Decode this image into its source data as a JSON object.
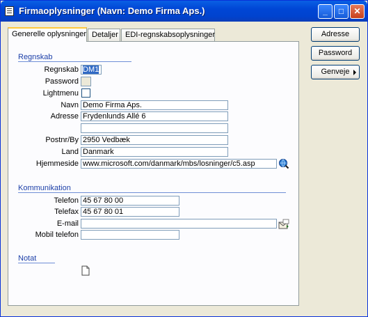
{
  "window": {
    "title": "Firmaoplysninger (Navn: Demo Firma Aps.)"
  },
  "titlebar_buttons": {
    "minimize": "_",
    "maximize": "□",
    "close": "✕"
  },
  "tabs": [
    {
      "label": "Generelle oplysninger",
      "active": true
    },
    {
      "label": "Detaljer",
      "active": false
    },
    {
      "label": "EDI-regnskabsoplysninger",
      "active": false
    }
  ],
  "side_buttons": {
    "adresse": "Adresse",
    "password": "Password",
    "genveje": "Genveje"
  },
  "regnskab": {
    "section": "Regnskab",
    "regnskab_label": "Regnskab",
    "regnskab_value": "DM1",
    "password_label": "Password",
    "lightmenu_label": "Lightmenu",
    "navn_label": "Navn",
    "navn_value": "Demo Firma Aps.",
    "adresse_label": "Adresse",
    "adresse_value": "Frydenlunds Allé 6",
    "adresse2_value": "",
    "postnr_label": "Postnr/By",
    "postnr_value": "2950  Vedbæk",
    "land_label": "Land",
    "land_value": "Danmark",
    "hjemmeside_label": "Hjemmeside",
    "hjemmeside_value": "www.microsoft.com/danmark/mbs/losninger/c5.asp"
  },
  "kommunikation": {
    "section": "Kommunikation",
    "telefon_label": "Telefon",
    "telefon_value": "45 67 80 00",
    "telefax_label": "Telefax",
    "telefax_value": "45 67 80 01",
    "email_label": "E-mail",
    "email_value": "",
    "mobil_label": "Mobil telefon",
    "mobil_value": ""
  },
  "notat": {
    "section": "Notat"
  },
  "icons": {
    "web": "globe-search-icon",
    "email": "email-send-icon",
    "note": "note-page-icon"
  }
}
